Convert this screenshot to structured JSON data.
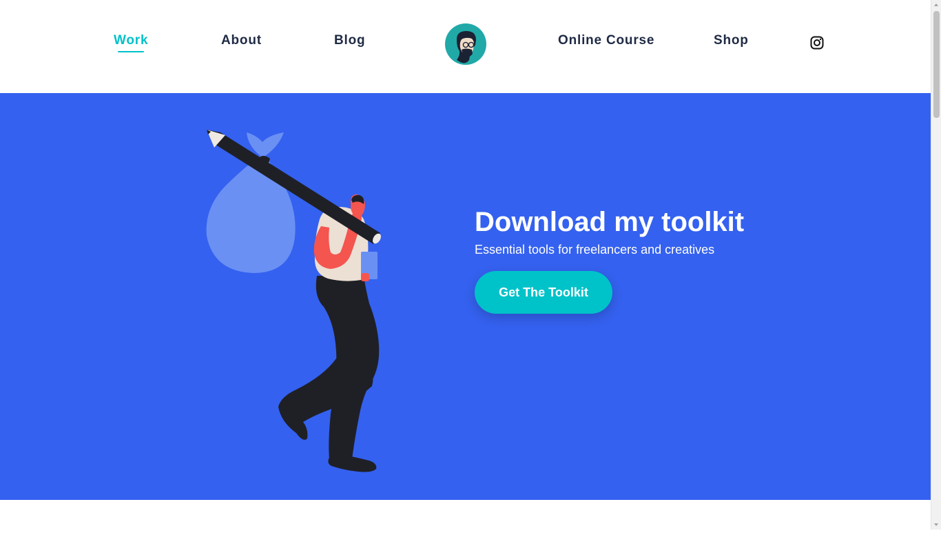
{
  "nav": {
    "items": [
      {
        "label": "Work",
        "active": true
      },
      {
        "label": "About",
        "active": false
      },
      {
        "label": "Blog",
        "active": false
      },
      {
        "label": "Online Course",
        "active": false
      },
      {
        "label": "Shop",
        "active": false
      }
    ],
    "logo_icon": "avatar-logo-icon",
    "social_icon": "instagram-icon"
  },
  "hero": {
    "title": "Download my toolkit",
    "subtitle": "Essential tools for freelancers and creatives",
    "cta_label": "Get The Toolkit",
    "illustration": "person-carrying-pencil-bundle-illustration"
  },
  "colors": {
    "accent": "#00c2c9",
    "hero_background": "#3461ef",
    "nav_text": "#1f2a44",
    "white": "#ffffff"
  }
}
